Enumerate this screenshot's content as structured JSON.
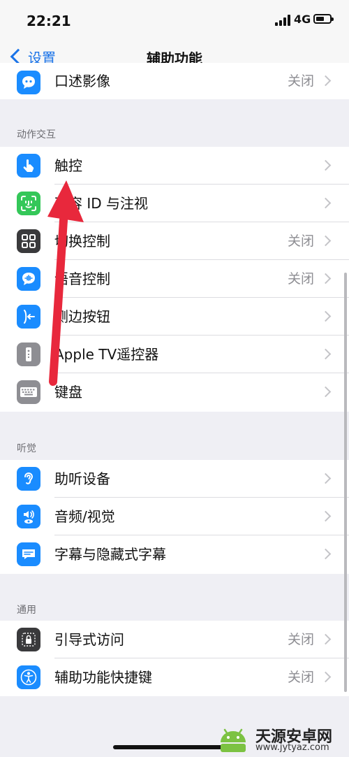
{
  "status": {
    "time": "22:21",
    "network": "4G"
  },
  "nav": {
    "back_label": "设置",
    "title": "辅助功能"
  },
  "top_item": {
    "label": "口述影像",
    "value": "关闭",
    "icon": "speech-bubble-icon"
  },
  "sections": [
    {
      "header": "动作交互",
      "items": [
        {
          "label": "触控",
          "value": "",
          "icon": "hand-touch-icon"
        },
        {
          "label": "面容 ID 与注视",
          "value": "",
          "icon": "face-id-icon"
        },
        {
          "label": "切换控制",
          "value": "关闭",
          "icon": "grid-icon"
        },
        {
          "label": "语音控制",
          "value": "关闭",
          "icon": "voice-control-icon"
        },
        {
          "label": "侧边按钮",
          "value": "",
          "icon": "side-button-icon"
        },
        {
          "label": "Apple TV遥控器",
          "value": "",
          "icon": "remote-icon"
        },
        {
          "label": "键盘",
          "value": "",
          "icon": "keyboard-icon"
        }
      ]
    },
    {
      "header": "听觉",
      "items": [
        {
          "label": "助听设备",
          "value": "",
          "icon": "ear-icon"
        },
        {
          "label": "音频/视觉",
          "value": "",
          "icon": "audio-visual-icon"
        },
        {
          "label": "字幕与隐藏式字幕",
          "value": "",
          "icon": "captions-icon"
        }
      ]
    },
    {
      "header": "通用",
      "items": [
        {
          "label": "引导式访问",
          "value": "关闭",
          "icon": "lock-icon"
        },
        {
          "label": "辅助功能快捷键",
          "value": "关闭",
          "icon": "accessibility-icon"
        }
      ]
    }
  ],
  "watermark": {
    "text": "天源安卓网",
    "url": "www.jytyaz.com"
  },
  "colors": {
    "accent": "#1a73e8",
    "annotation_arrow": "#e8283c",
    "face_id_green": "#34c759"
  }
}
